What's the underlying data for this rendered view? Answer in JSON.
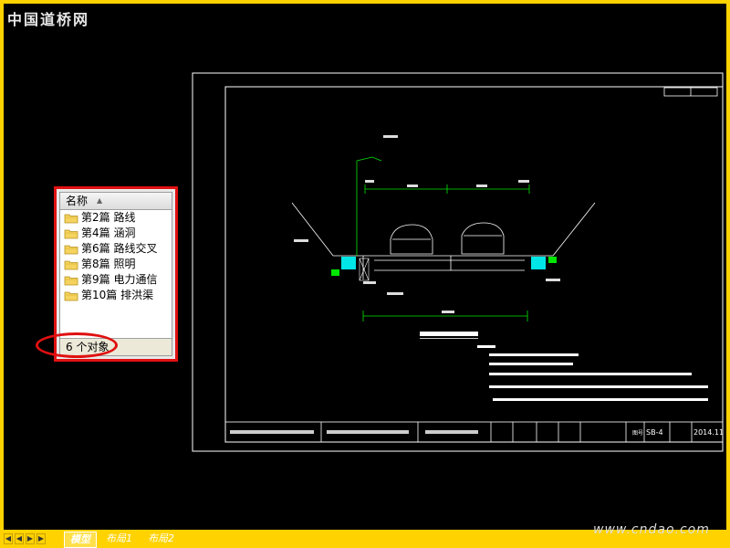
{
  "watermark": "中国道桥网",
  "file_list": {
    "header": "名称",
    "items": [
      {
        "label": "第2篇 路线"
      },
      {
        "label": "第4篇 涵洞"
      },
      {
        "label": "第6篇 路线交叉"
      },
      {
        "label": "第8篇 照明"
      },
      {
        "label": "第9篇 电力通信"
      },
      {
        "label": "第10篇 排洪渠"
      }
    ],
    "status": "6 个对象"
  },
  "drawing": {
    "sheet_no": "SB-4",
    "date": "2014.11",
    "title_label": "图号"
  },
  "tabs": [
    "模型",
    "布局1",
    "布局2"
  ],
  "site": "www.cndao.com",
  "colors": {
    "cad_bg": "#000000",
    "frame": "#ffffff",
    "accent": "#ffd200",
    "highlight": "#e01010",
    "cyan": "#00e5e5",
    "green": "#00e600"
  }
}
